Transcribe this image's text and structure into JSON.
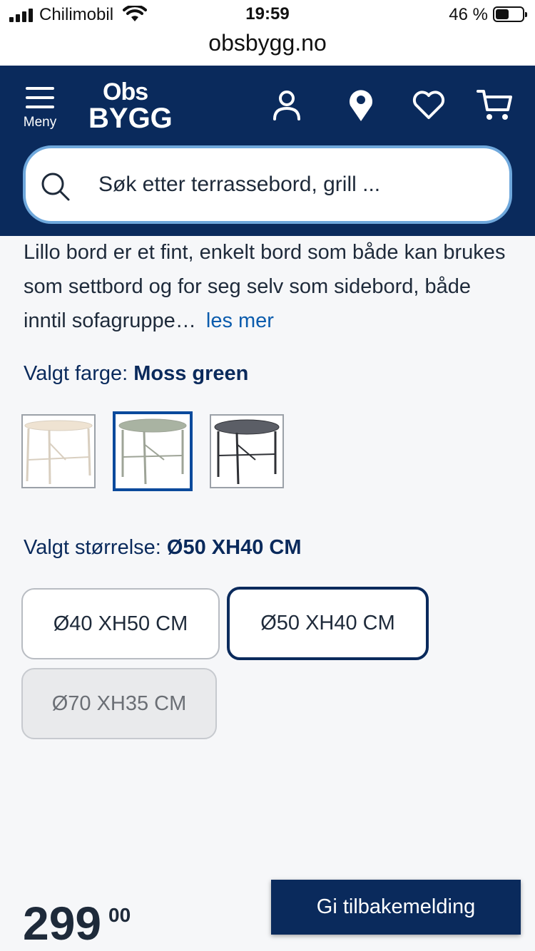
{
  "status_bar": {
    "carrier": "Chilimobil",
    "time": "19:59",
    "battery": "46 %"
  },
  "browser": {
    "url": "obsbygg.no"
  },
  "header": {
    "menu_label": "Meny",
    "logo_line1": "Obs",
    "logo_line2": "BYGG",
    "icons": [
      "user-icon",
      "location-pin-icon",
      "heart-icon",
      "cart-icon"
    ],
    "search_placeholder": "Søk etter terrassebord, grill ..."
  },
  "product": {
    "description": "Lillo bord er et fint, enkelt bord som både kan brukes som settbord og for seg selv som sidebord, både inntil sofagruppe…",
    "read_more": "les mer",
    "color_label": "Valgt farge:",
    "color_value": "Moss green",
    "colors": [
      {
        "name": "beige",
        "top": "#efe3d2",
        "leg": "#d9cfc0",
        "selected": false
      },
      {
        "name": "moss-green",
        "top": "#a9b3a2",
        "leg": "#9ea497",
        "selected": true
      },
      {
        "name": "dark-grey",
        "top": "#5b5e66",
        "leg": "#2f3136",
        "selected": false
      }
    ],
    "size_label": "Valgt størrelse:",
    "size_value": "Ø50 XH40 CM",
    "sizes": [
      {
        "label": "Ø40 XH50 CM",
        "state": "available"
      },
      {
        "label": "Ø50 XH40 CM",
        "state": "selected"
      },
      {
        "label": "Ø70 XH35 CM",
        "state": "disabled"
      }
    ],
    "price_int": "299",
    "price_dec": "00"
  },
  "feedback_button": "Gi tilbakemelding",
  "colors": {
    "header_bg": "#0a2a5c",
    "link": "#0b5cad",
    "search_border": "#6fa8dc"
  }
}
